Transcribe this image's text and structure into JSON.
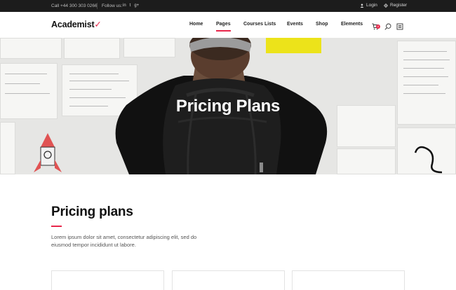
{
  "topbar": {
    "phone": "Call +44 300 303 0266",
    "follow": "Follow us:",
    "social_icons": [
      "linkedin-icon",
      "twitter-icon",
      "googleplus-icon"
    ],
    "social_glyphs": [
      "in",
      "t",
      "g+"
    ],
    "login": "Login",
    "register": "Register"
  },
  "header": {
    "logo": "Academist",
    "nav": [
      "Home",
      "Pages",
      "Courses Lists",
      "Events",
      "Shop",
      "Elements"
    ],
    "active_nav": "Pages",
    "cart_count": "0"
  },
  "hero": {
    "title": "Pricing Plans"
  },
  "content": {
    "title": "Pricing plans",
    "description": "Lorem ipsum dolor sit amet, consectetur adipiscing elit, sed do eiusmod tempor incididunt ut labore."
  },
  "colors": {
    "accent": "#e8274b",
    "topbar": "#1c1c1c"
  }
}
